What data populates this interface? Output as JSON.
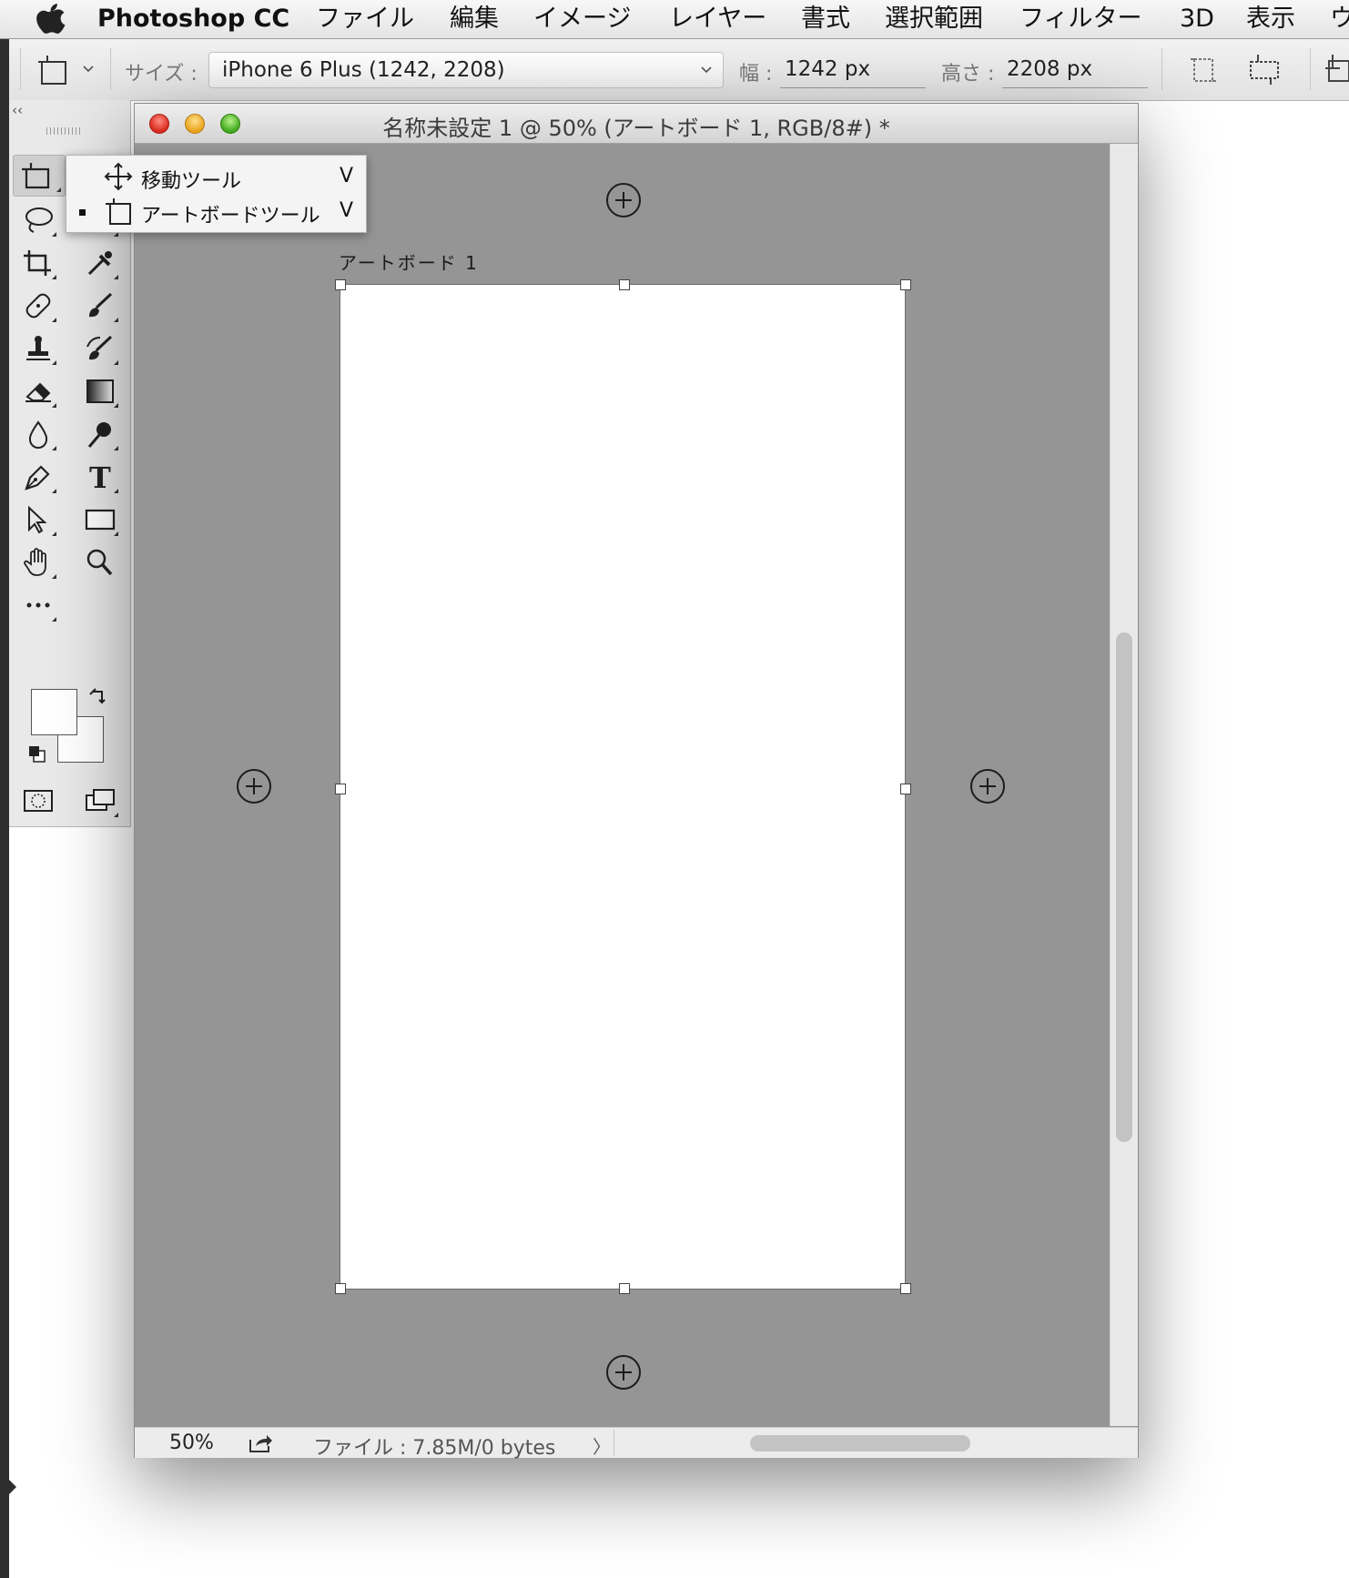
{
  "menubar": {
    "app_name": "Photoshop CC",
    "items": [
      "ファイル",
      "編集",
      "イメージ",
      "レイヤー",
      "書式",
      "選択範囲",
      "フィルター",
      "3D",
      "表示",
      "ウ"
    ]
  },
  "optionsbar": {
    "size_label": "サイズ :",
    "size_value": "iPhone 6 Plus (1242, 2208)",
    "width_label": "幅 :",
    "width_value": "1242 px",
    "height_label": "高さ :",
    "height_value": "2208 px"
  },
  "toolpanel": {
    "collapse": "‹‹",
    "tools": [
      "artboard-tool",
      "lasso-tool",
      "quick-select-tool",
      "crop-tool",
      "eyedropper-tool",
      "healing-brush-tool",
      "brush-tool",
      "clone-stamp-tool",
      "history-brush-tool",
      "eraser-tool",
      "gradient-tool",
      "blur-tool",
      "dodge-tool",
      "pen-tool",
      "type-tool",
      "path-selection-tool",
      "rectangle-tool",
      "hand-tool",
      "zoom-tool",
      "more-tools"
    ],
    "colors": {
      "foreground": "#ffffff",
      "background": "#ffffff"
    }
  },
  "flyout": {
    "items": [
      {
        "label": "移動ツール",
        "shortcut": "V",
        "selected": false,
        "icon": "move-icon"
      },
      {
        "label": "アートボードツール",
        "shortcut": "V",
        "selected": true,
        "icon": "artboard-icon"
      }
    ]
  },
  "document": {
    "title": "名称未設定 1 @ 50% (アートボード 1, RGB/8#) *",
    "artboard_label": "アートボード 1",
    "canvas_color": "#959595"
  },
  "status": {
    "zoom": "50%",
    "file_info": "ファイル : 7.85M/0 bytes",
    "arrow": "〉"
  }
}
